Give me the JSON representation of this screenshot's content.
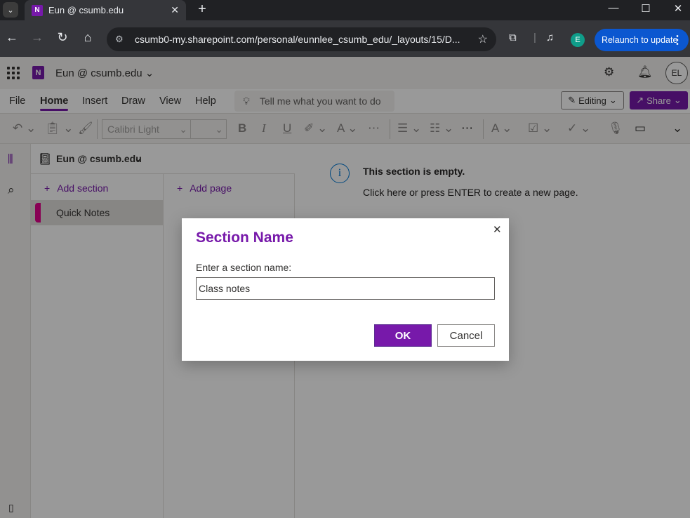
{
  "browser": {
    "tab_title": "Eun @ csumb.edu",
    "tab_favicon_letter": "N",
    "url": "csumb0-my.sharepoint.com/personal/eunnlee_csumb_edu/_layouts/15/D...",
    "profile_initial": "E",
    "relaunch_label": "Relaunch to update"
  },
  "app": {
    "notebook_title": "Eun @ csumb.edu",
    "avatar_initials": "EL",
    "menu": [
      "File",
      "Home",
      "Insert",
      "Draw",
      "View",
      "Help"
    ],
    "active_menu": "Home",
    "tell_me_placeholder": "Tell me what you want to do",
    "editing_label": "Editing",
    "share_label": "Share",
    "font_name": "Calibri Light",
    "notebook_selector": "Eun @ csumb.edu",
    "add_section_label": "Add section",
    "add_page_label": "Add page",
    "sections": [
      {
        "label": "Quick Notes",
        "color": "#e3008c"
      }
    ],
    "empty_title": "This section is empty.",
    "empty_hint": "Click here or press ENTER to create a new page."
  },
  "dialog": {
    "title": "Section Name",
    "prompt": "Enter a section name:",
    "input_value": "Class notes",
    "ok_label": "OK",
    "cancel_label": "Cancel"
  },
  "colors": {
    "accent": "#7719aa",
    "browser_relaunch": "#0b57d0"
  }
}
